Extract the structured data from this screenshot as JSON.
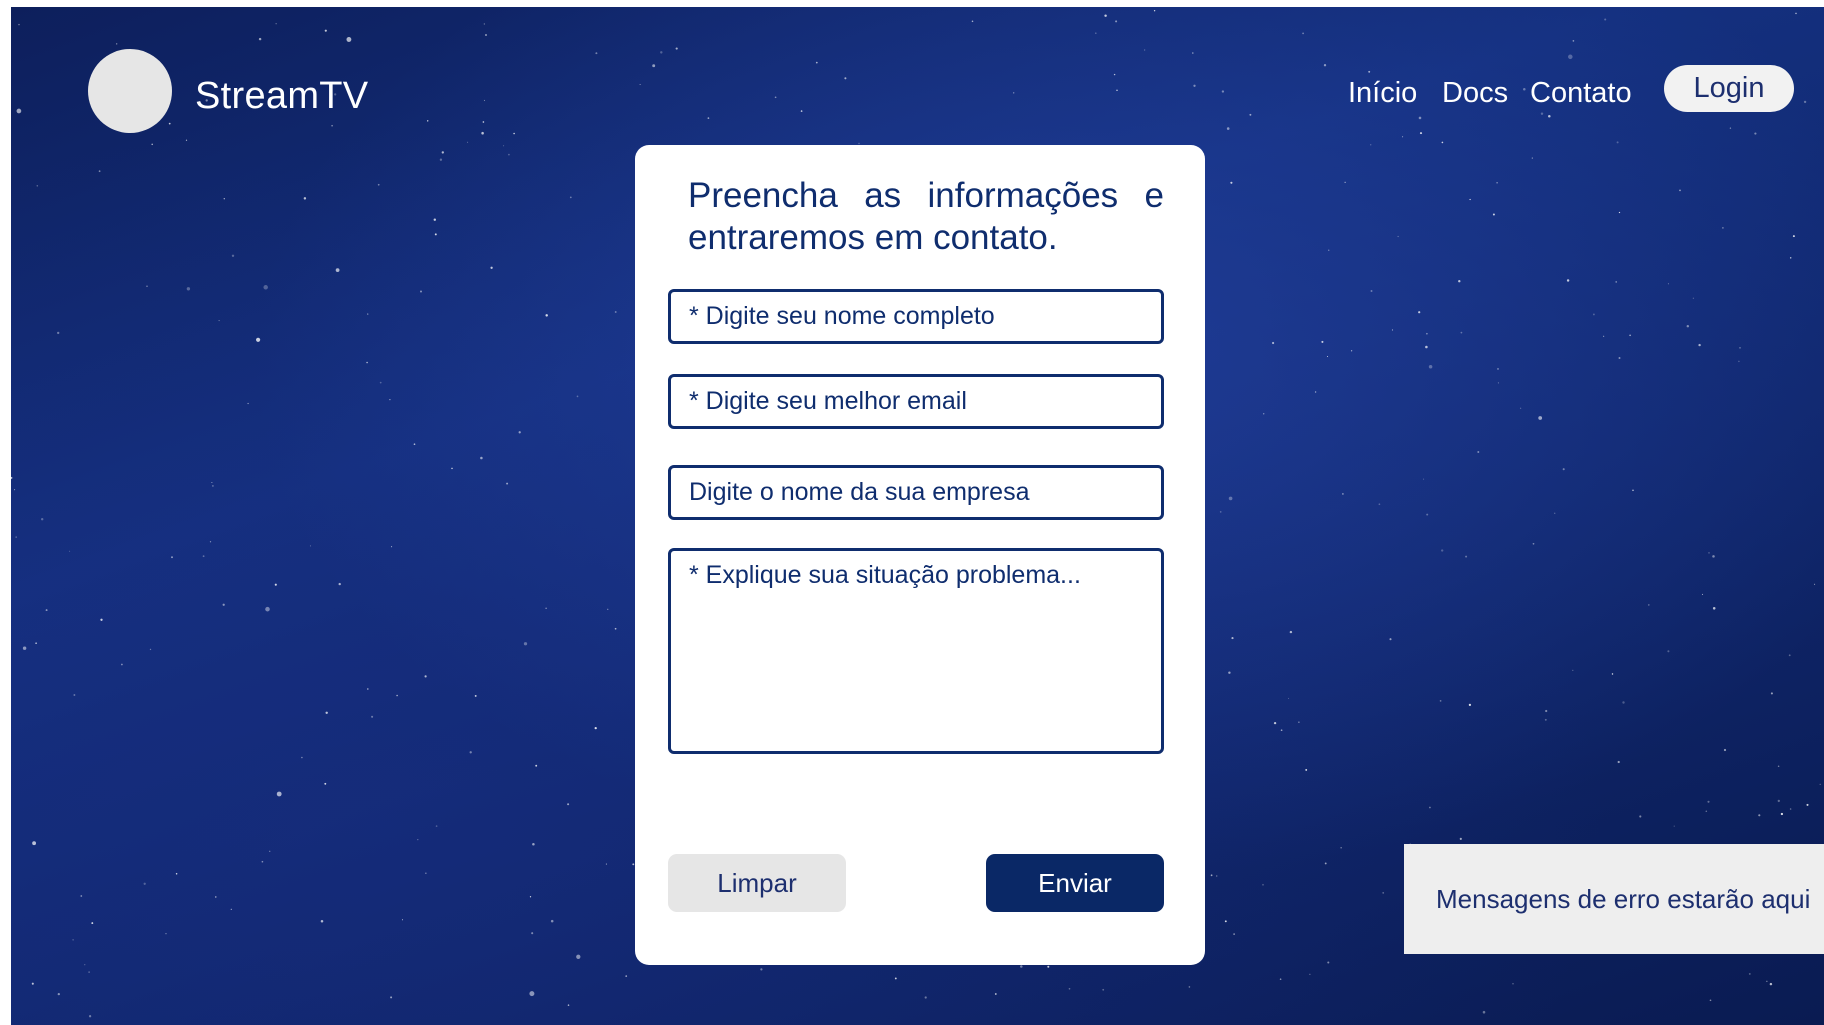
{
  "header": {
    "brand": "StreamTV",
    "nav": {
      "inicio": "Início",
      "docs": "Docs",
      "contato": "Contato",
      "login": "Login"
    }
  },
  "form": {
    "heading": "Preencha as informações e entraremos em contato.",
    "name_placeholder": "* Digite seu nome completo",
    "email_placeholder": "* Digite seu melhor email",
    "company_placeholder": "Digite o nome da sua empresa",
    "problem_placeholder": "* Explique sua situação problema...",
    "clear_label": "Limpar",
    "send_label": "Enviar"
  },
  "error_panel": {
    "message": "Mensagens de erro estarão aqui"
  },
  "colors": {
    "background": "#122a75",
    "primary": "#0a2866",
    "text_primary": "#0f2d6e",
    "light_gray": "#e6e6e6"
  },
  "icons": {
    "logo": "logo-placeholder-circle"
  }
}
